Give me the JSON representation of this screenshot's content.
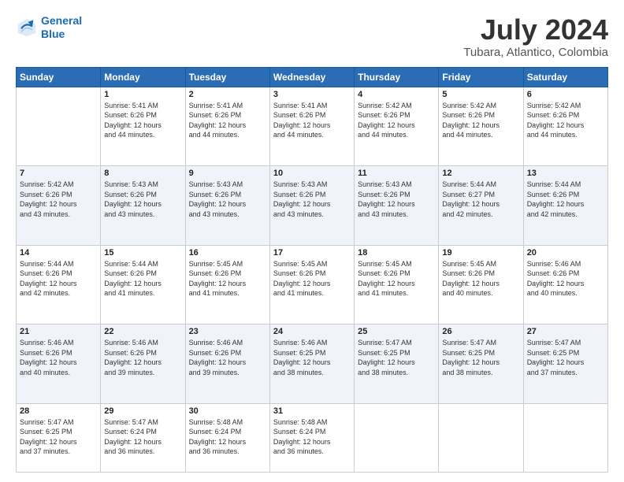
{
  "header": {
    "logo_line1": "General",
    "logo_line2": "Blue",
    "title": "July 2024",
    "subtitle": "Tubara, Atlantico, Colombia"
  },
  "days_of_week": [
    "Sunday",
    "Monday",
    "Tuesday",
    "Wednesday",
    "Thursday",
    "Friday",
    "Saturday"
  ],
  "weeks": [
    [
      {
        "day": "",
        "info": ""
      },
      {
        "day": "1",
        "info": "Sunrise: 5:41 AM\nSunset: 6:26 PM\nDaylight: 12 hours\nand 44 minutes."
      },
      {
        "day": "2",
        "info": "Sunrise: 5:41 AM\nSunset: 6:26 PM\nDaylight: 12 hours\nand 44 minutes."
      },
      {
        "day": "3",
        "info": "Sunrise: 5:41 AM\nSunset: 6:26 PM\nDaylight: 12 hours\nand 44 minutes."
      },
      {
        "day": "4",
        "info": "Sunrise: 5:42 AM\nSunset: 6:26 PM\nDaylight: 12 hours\nand 44 minutes."
      },
      {
        "day": "5",
        "info": "Sunrise: 5:42 AM\nSunset: 6:26 PM\nDaylight: 12 hours\nand 44 minutes."
      },
      {
        "day": "6",
        "info": "Sunrise: 5:42 AM\nSunset: 6:26 PM\nDaylight: 12 hours\nand 44 minutes."
      }
    ],
    [
      {
        "day": "7",
        "info": "Sunrise: 5:42 AM\nSunset: 6:26 PM\nDaylight: 12 hours\nand 43 minutes."
      },
      {
        "day": "8",
        "info": "Sunrise: 5:43 AM\nSunset: 6:26 PM\nDaylight: 12 hours\nand 43 minutes."
      },
      {
        "day": "9",
        "info": "Sunrise: 5:43 AM\nSunset: 6:26 PM\nDaylight: 12 hours\nand 43 minutes."
      },
      {
        "day": "10",
        "info": "Sunrise: 5:43 AM\nSunset: 6:26 PM\nDaylight: 12 hours\nand 43 minutes."
      },
      {
        "day": "11",
        "info": "Sunrise: 5:43 AM\nSunset: 6:26 PM\nDaylight: 12 hours\nand 43 minutes."
      },
      {
        "day": "12",
        "info": "Sunrise: 5:44 AM\nSunset: 6:27 PM\nDaylight: 12 hours\nand 42 minutes."
      },
      {
        "day": "13",
        "info": "Sunrise: 5:44 AM\nSunset: 6:26 PM\nDaylight: 12 hours\nand 42 minutes."
      }
    ],
    [
      {
        "day": "14",
        "info": "Sunrise: 5:44 AM\nSunset: 6:26 PM\nDaylight: 12 hours\nand 42 minutes."
      },
      {
        "day": "15",
        "info": "Sunrise: 5:44 AM\nSunset: 6:26 PM\nDaylight: 12 hours\nand 41 minutes."
      },
      {
        "day": "16",
        "info": "Sunrise: 5:45 AM\nSunset: 6:26 PM\nDaylight: 12 hours\nand 41 minutes."
      },
      {
        "day": "17",
        "info": "Sunrise: 5:45 AM\nSunset: 6:26 PM\nDaylight: 12 hours\nand 41 minutes."
      },
      {
        "day": "18",
        "info": "Sunrise: 5:45 AM\nSunset: 6:26 PM\nDaylight: 12 hours\nand 41 minutes."
      },
      {
        "day": "19",
        "info": "Sunrise: 5:45 AM\nSunset: 6:26 PM\nDaylight: 12 hours\nand 40 minutes."
      },
      {
        "day": "20",
        "info": "Sunrise: 5:46 AM\nSunset: 6:26 PM\nDaylight: 12 hours\nand 40 minutes."
      }
    ],
    [
      {
        "day": "21",
        "info": "Sunrise: 5:46 AM\nSunset: 6:26 PM\nDaylight: 12 hours\nand 40 minutes."
      },
      {
        "day": "22",
        "info": "Sunrise: 5:46 AM\nSunset: 6:26 PM\nDaylight: 12 hours\nand 39 minutes."
      },
      {
        "day": "23",
        "info": "Sunrise: 5:46 AM\nSunset: 6:26 PM\nDaylight: 12 hours\nand 39 minutes."
      },
      {
        "day": "24",
        "info": "Sunrise: 5:46 AM\nSunset: 6:25 PM\nDaylight: 12 hours\nand 38 minutes."
      },
      {
        "day": "25",
        "info": "Sunrise: 5:47 AM\nSunset: 6:25 PM\nDaylight: 12 hours\nand 38 minutes."
      },
      {
        "day": "26",
        "info": "Sunrise: 5:47 AM\nSunset: 6:25 PM\nDaylight: 12 hours\nand 38 minutes."
      },
      {
        "day": "27",
        "info": "Sunrise: 5:47 AM\nSunset: 6:25 PM\nDaylight: 12 hours\nand 37 minutes."
      }
    ],
    [
      {
        "day": "28",
        "info": "Sunrise: 5:47 AM\nSunset: 6:25 PM\nDaylight: 12 hours\nand 37 minutes."
      },
      {
        "day": "29",
        "info": "Sunrise: 5:47 AM\nSunset: 6:24 PM\nDaylight: 12 hours\nand 36 minutes."
      },
      {
        "day": "30",
        "info": "Sunrise: 5:48 AM\nSunset: 6:24 PM\nDaylight: 12 hours\nand 36 minutes."
      },
      {
        "day": "31",
        "info": "Sunrise: 5:48 AM\nSunset: 6:24 PM\nDaylight: 12 hours\nand 36 minutes."
      },
      {
        "day": "",
        "info": ""
      },
      {
        "day": "",
        "info": ""
      },
      {
        "day": "",
        "info": ""
      }
    ]
  ]
}
